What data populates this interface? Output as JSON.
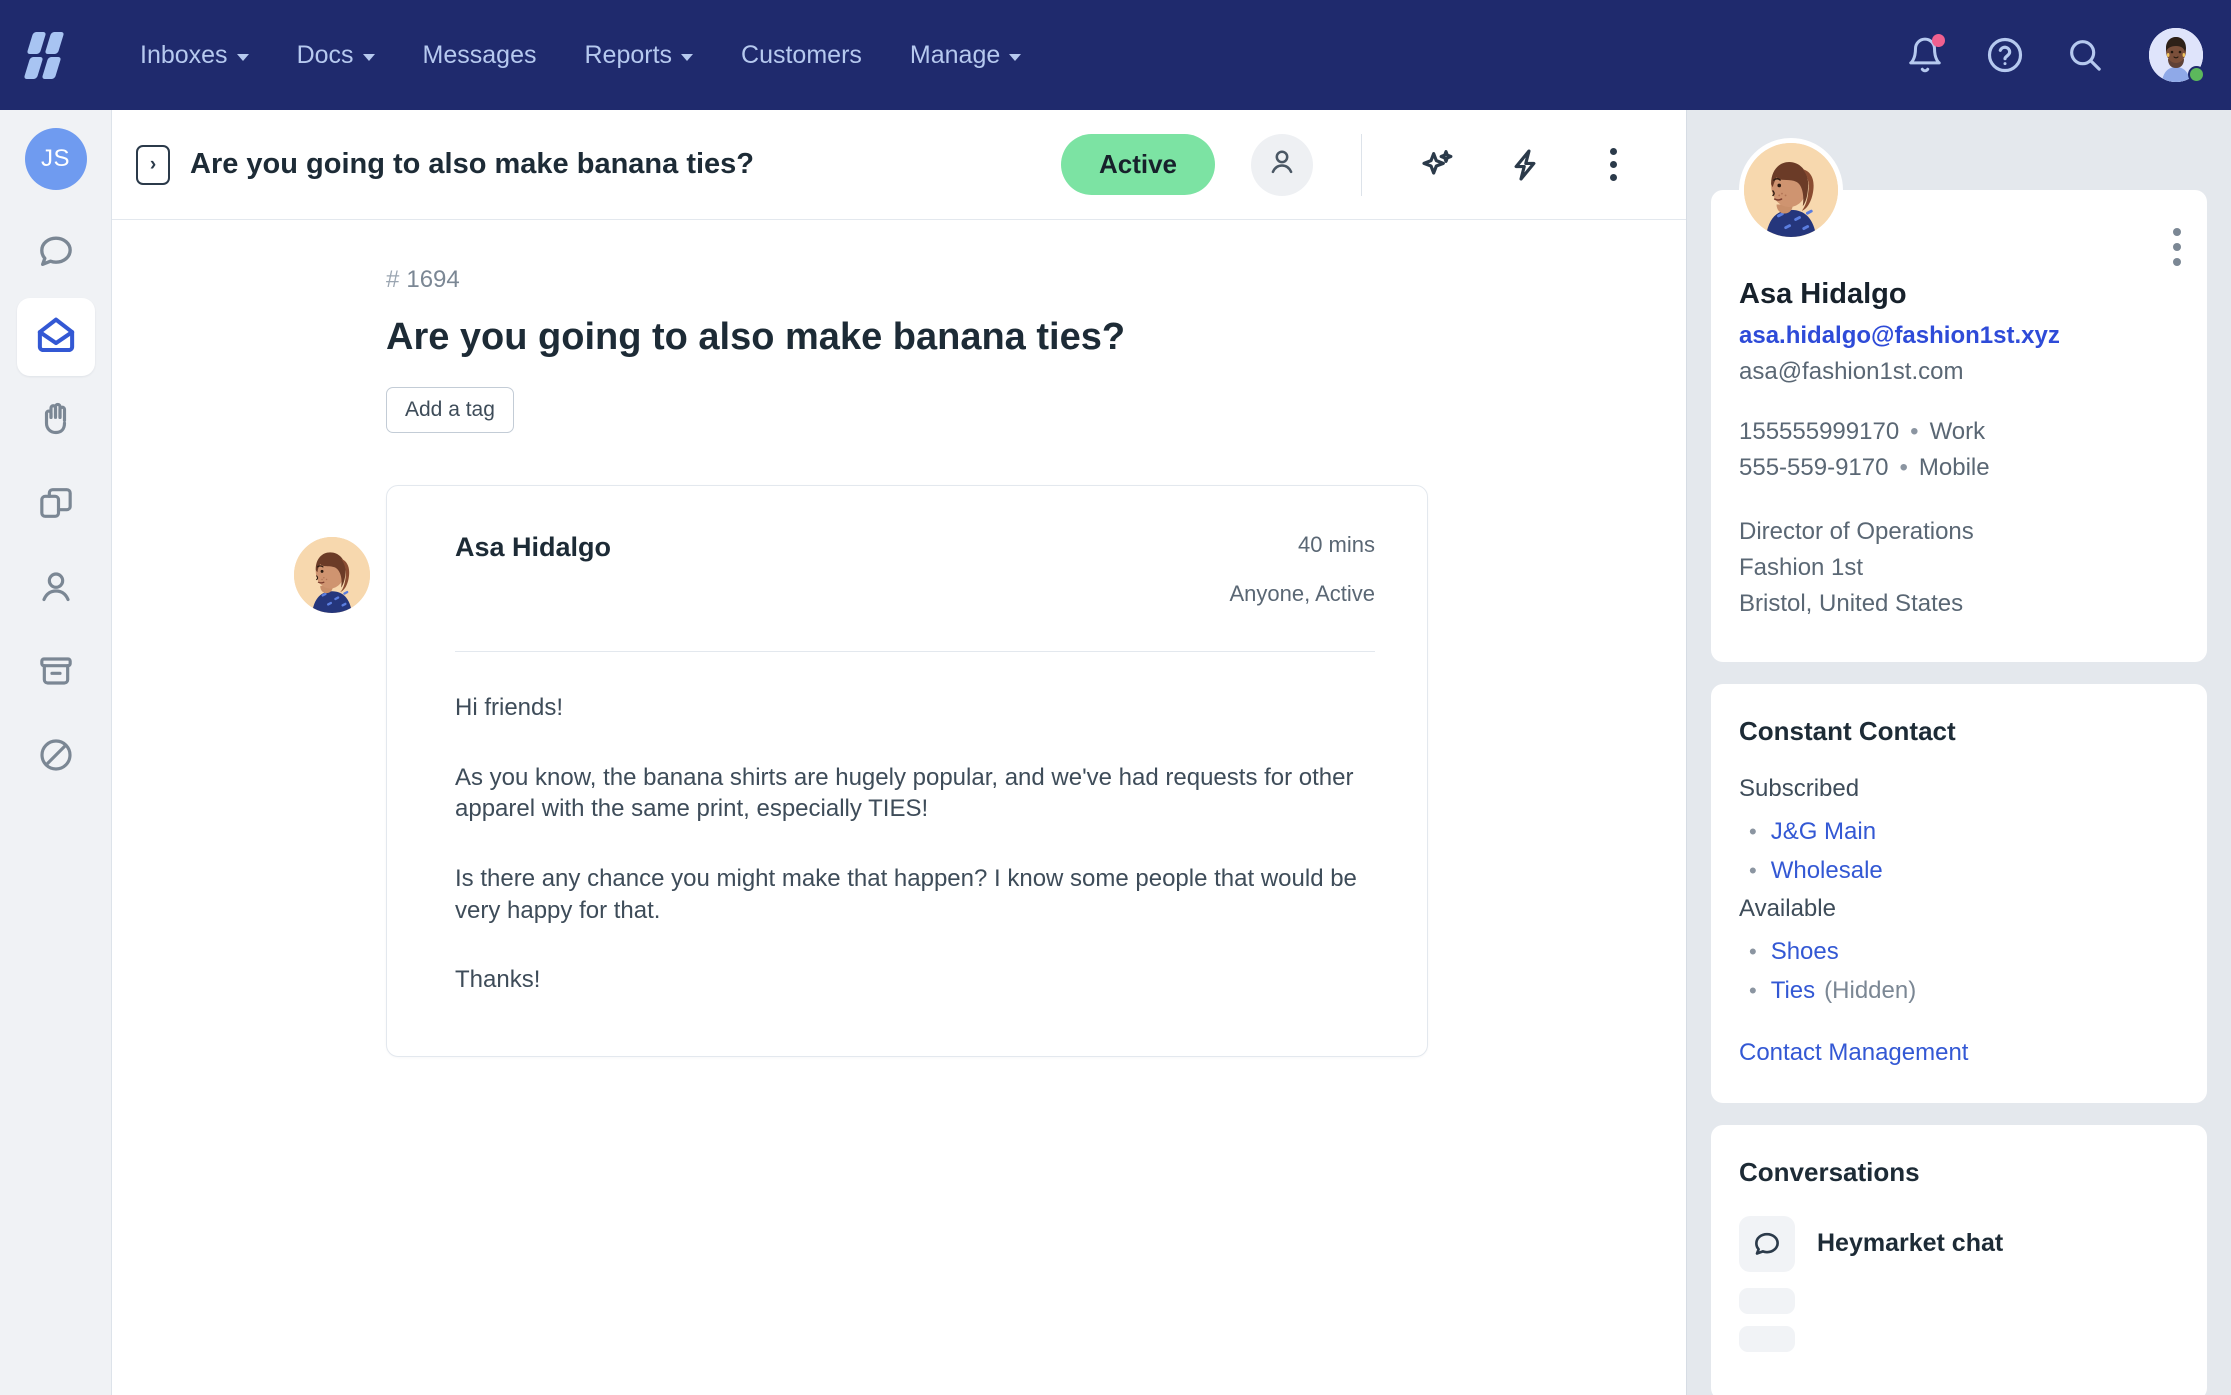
{
  "topnav": {
    "logo_name": "heymarket-logo",
    "items": [
      {
        "label": "Inboxes",
        "has_caret": true
      },
      {
        "label": "Docs",
        "has_caret": true
      },
      {
        "label": "Messages",
        "has_caret": false
      },
      {
        "label": "Reports",
        "has_caret": true
      },
      {
        "label": "Customers",
        "has_caret": false
      },
      {
        "label": "Manage",
        "has_caret": true
      }
    ],
    "icons": [
      {
        "name": "notifications-bell-icon",
        "has_badge": true
      },
      {
        "name": "help-circle-icon",
        "has_badge": false
      },
      {
        "name": "search-icon",
        "has_badge": false
      }
    ],
    "avatar_name": "user-avatar",
    "online": true,
    "bg_color": "#1f2a6d",
    "text_color": "#b6c9ef"
  },
  "rail": {
    "user_initials": "JS",
    "items": [
      {
        "name": "chats-icon",
        "active": false
      },
      {
        "name": "inbox-open-envelope-icon",
        "active": true
      },
      {
        "name": "hand-wave-icon",
        "active": false
      },
      {
        "name": "docs-pages-icon",
        "active": false
      },
      {
        "name": "customers-person-icon",
        "active": false
      },
      {
        "name": "archive-box-icon",
        "active": false
      },
      {
        "name": "spam-blocked-icon",
        "active": false
      }
    ],
    "active_color": "#3358d4",
    "avatar_color": "#6f9bf0"
  },
  "conversation_header": {
    "toggle_icon": "expand-sidebar-icon",
    "title": "Are you going to also make banana ties?",
    "status_label": "Active",
    "status_color": "#7ce3a3",
    "assignee_icon": "assignee-person-icon",
    "actions": [
      {
        "name": "ai-assist-sparkle-icon"
      },
      {
        "name": "workflow-lightning-icon"
      },
      {
        "name": "more-options-kebab-icon"
      }
    ]
  },
  "thread": {
    "number_prefix": "#",
    "number": "1694",
    "title": "Are you going to also make banana ties?",
    "add_tag_label": "Add a tag",
    "message": {
      "author": "Asa Hidalgo",
      "time": "40 mins",
      "visibility": "Anyone, Active",
      "paragraphs": [
        "Hi friends!",
        "As you know, the banana shirts are hugely popular, and we've had requests for other apparel with the same print, especially TIES!",
        "Is there any chance you might make that happen? I know some people that would be very happy for that.",
        "Thanks!"
      ]
    }
  },
  "right_panel": {
    "contact": {
      "avatar_name": "contact-avatar",
      "menu_icon": "contact-more-kebab-icon",
      "name": "Asa Hidalgo",
      "primary_email": "asa.hidalgo@fashion1st.xyz",
      "secondary_email": "asa@fashion1st.com",
      "phones": [
        {
          "number": "155555999170",
          "type": "Work"
        },
        {
          "number": "555-559-9170",
          "type": "Mobile"
        }
      ],
      "job_title": "Director of Operations",
      "company": "Fashion 1st",
      "location": "Bristol, United States"
    },
    "constant_contact": {
      "title": "Constant Contact",
      "subscribed_label": "Subscribed",
      "subscribed": [
        {
          "label": "J&G Main",
          "note": ""
        },
        {
          "label": "Wholesale",
          "note": ""
        }
      ],
      "available_label": "Available",
      "available": [
        {
          "label": "Shoes",
          "note": ""
        },
        {
          "label": "Ties",
          "note": "(Hidden)"
        }
      ],
      "footer_link": "Contact Management"
    },
    "conversations": {
      "title": "Conversations",
      "items": [
        {
          "label": "Heymarket chat",
          "icon": "chat-bubble-icon"
        }
      ]
    }
  }
}
